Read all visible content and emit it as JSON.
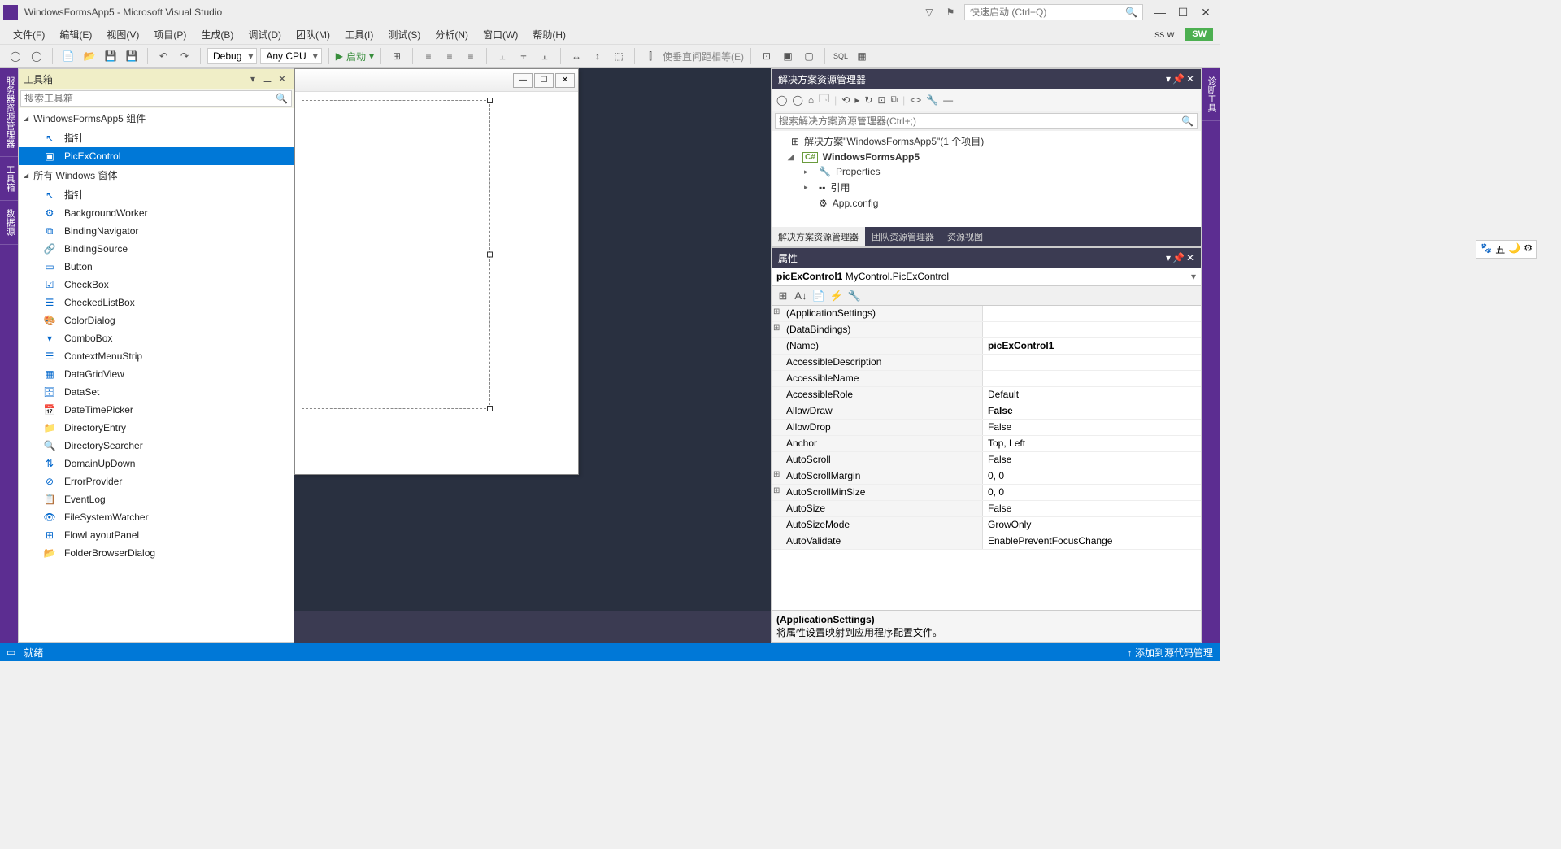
{
  "title": "WindowsFormsApp5 - Microsoft Visual Studio",
  "quicklaunch_placeholder": "快速启动 (Ctrl+Q)",
  "user_badge": "SW",
  "user_label": "ss w",
  "menu": [
    "文件(F)",
    "编辑(E)",
    "视图(V)",
    "项目(P)",
    "生成(B)",
    "调试(D)",
    "团队(M)",
    "工具(I)",
    "测试(S)",
    "分析(N)",
    "窗口(W)",
    "帮助(H)"
  ],
  "config": "Debug",
  "platform": "Any CPU",
  "start_label": "启动",
  "align_label": "使垂直间距相等(E)",
  "side_tabs_left": [
    "服务器资源管理器",
    "工具箱",
    "数据源"
  ],
  "side_tabs_right": [
    "诊断工具"
  ],
  "toolbox": {
    "title": "工具箱",
    "search_placeholder": "搜索工具箱",
    "cat1": "WindowsFormsApp5 组件",
    "cat1_items": [
      "指针",
      "PicExControl"
    ],
    "selected": "PicExControl",
    "cat2": "所有 Windows 窗体",
    "cat2_items": [
      "指针",
      "BackgroundWorker",
      "BindingNavigator",
      "BindingSource",
      "Button",
      "CheckBox",
      "CheckedListBox",
      "ColorDialog",
      "ComboBox",
      "ContextMenuStrip",
      "DataGridView",
      "DataSet",
      "DateTimePicker",
      "DirectoryEntry",
      "DirectorySearcher",
      "DomainUpDown",
      "ErrorProvider",
      "EventLog",
      "FileSystemWatcher",
      "FlowLayoutPanel",
      "FolderBrowserDialog"
    ]
  },
  "solution": {
    "title": "解决方案资源管理器",
    "search_placeholder": "搜索解决方案资源管理器(Ctrl+;)",
    "root": "解决方案\"WindowsFormsApp5\"(1 个项目)",
    "project": "WindowsFormsApp5",
    "nodes": [
      "Properties",
      "引用",
      "App.config"
    ],
    "tabs": [
      "解决方案资源管理器",
      "团队资源管理器",
      "资源视图"
    ]
  },
  "properties": {
    "title": "属性",
    "selector_name": "picExControl1",
    "selector_type": "MyControl.PicExControl",
    "rows": [
      {
        "n": "(ApplicationSettings)",
        "v": "",
        "exp": true
      },
      {
        "n": "(DataBindings)",
        "v": "",
        "exp": true
      },
      {
        "n": "(Name)",
        "v": "picExControl1",
        "bold": true
      },
      {
        "n": "AccessibleDescription",
        "v": ""
      },
      {
        "n": "AccessibleName",
        "v": ""
      },
      {
        "n": "AccessibleRole",
        "v": "Default"
      },
      {
        "n": "AllawDraw",
        "v": "False",
        "bold": true
      },
      {
        "n": "AllowDrop",
        "v": "False"
      },
      {
        "n": "Anchor",
        "v": "Top, Left"
      },
      {
        "n": "AutoScroll",
        "v": "False"
      },
      {
        "n": "AutoScrollMargin",
        "v": "0, 0",
        "exp": true
      },
      {
        "n": "AutoScrollMinSize",
        "v": "0, 0",
        "exp": true
      },
      {
        "n": "AutoSize",
        "v": "False"
      },
      {
        "n": "AutoSizeMode",
        "v": "GrowOnly"
      },
      {
        "n": "AutoValidate",
        "v": "EnablePreventFocusChange"
      }
    ],
    "desc_name": "(ApplicationSettings)",
    "desc_text": "将属性设置映射到应用程序配置文件。"
  },
  "status": {
    "ready": "就绪",
    "right": "↑ 添加到源代码管理"
  }
}
